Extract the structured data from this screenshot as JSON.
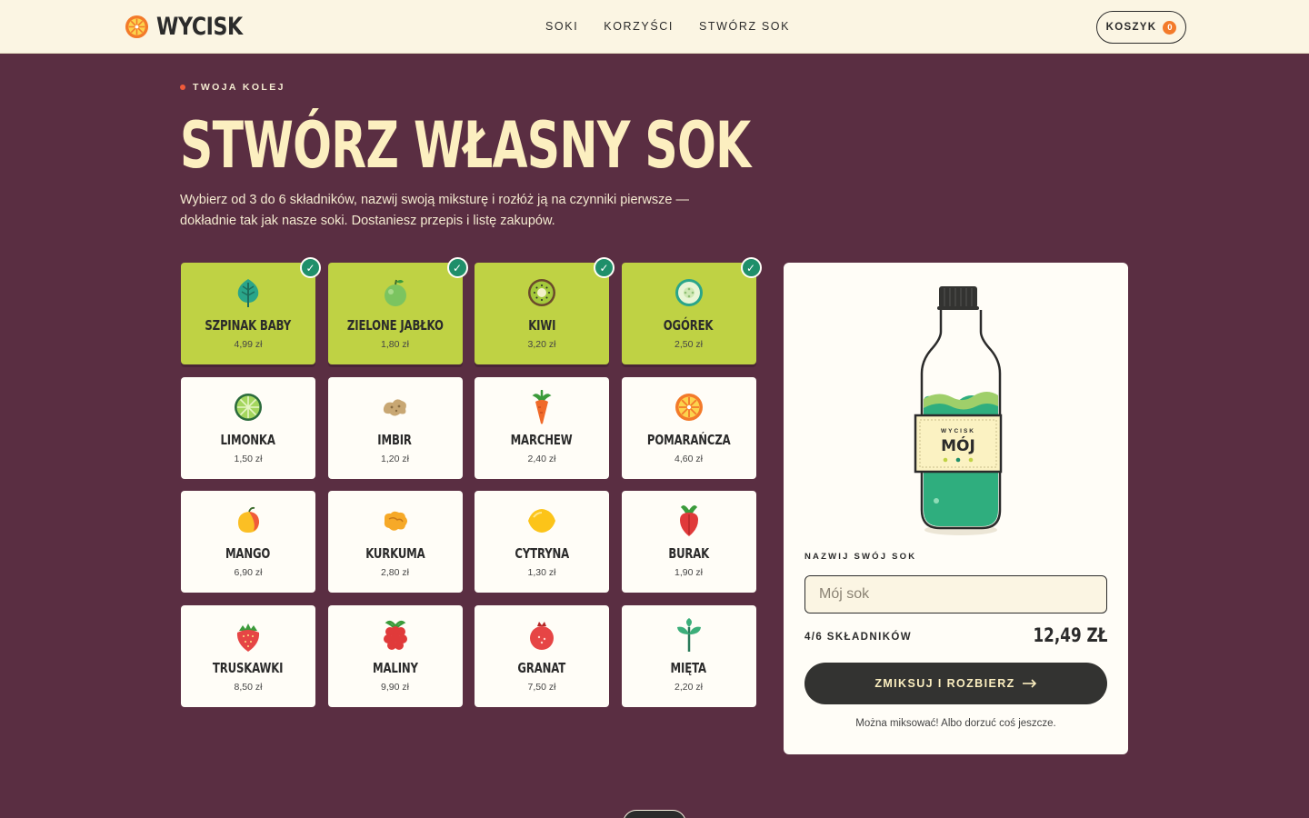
{
  "header": {
    "brand": "WYCISK",
    "nav": [
      "SOKI",
      "KORZYŚCI",
      "STWÓRZ SOK"
    ],
    "cart_label": "KOSZYK",
    "cart_count": "0"
  },
  "hero": {
    "eyebrow": "TWOJA KOLEJ",
    "title": "STWÓRZ WŁASNY SOK",
    "description": "Wybierz od 3 do 6 składników, nazwij swoją miksturę i rozłóż ją na czynniki pierwsze — dokładnie tak jak nasze soki. Dostaniesz przepis i listę zakupów."
  },
  "ingredients": [
    {
      "name": "SZPINAK BABY",
      "price": "4,99 zł",
      "selected": true,
      "icon": "spinach-leaf-icon"
    },
    {
      "name": "ZIELONE JABŁKO",
      "price": "1,80 zł",
      "selected": true,
      "icon": "green-apple-icon"
    },
    {
      "name": "KIWI",
      "price": "3,20 zł",
      "selected": true,
      "icon": "kiwi-icon"
    },
    {
      "name": "OGÓREK",
      "price": "2,50 zł",
      "selected": true,
      "icon": "cucumber-icon"
    },
    {
      "name": "LIMONKA",
      "price": "1,50 zł",
      "selected": false,
      "icon": "lime-icon"
    },
    {
      "name": "IMBIR",
      "price": "1,20 zł",
      "selected": false,
      "icon": "ginger-icon"
    },
    {
      "name": "MARCHEW",
      "price": "2,40 zł",
      "selected": false,
      "icon": "carrot-icon"
    },
    {
      "name": "POMARAŃCZA",
      "price": "4,60 zł",
      "selected": false,
      "icon": "orange-icon"
    },
    {
      "name": "MANGO",
      "price": "6,90 zł",
      "selected": false,
      "icon": "mango-icon"
    },
    {
      "name": "KURKUMA",
      "price": "2,80 zł",
      "selected": false,
      "icon": "turmeric-icon"
    },
    {
      "name": "CYTRYNA",
      "price": "1,30 zł",
      "selected": false,
      "icon": "lemon-icon"
    },
    {
      "name": "BURAK",
      "price": "1,90 zł",
      "selected": false,
      "icon": "beetroot-icon"
    },
    {
      "name": "TRUSKAWKI",
      "price": "8,50 zł",
      "selected": false,
      "icon": "strawberry-icon"
    },
    {
      "name": "MALINY",
      "price": "9,90 zł",
      "selected": false,
      "icon": "raspberry-icon"
    },
    {
      "name": "GRANAT",
      "price": "7,50 zł",
      "selected": false,
      "icon": "pomegranate-icon"
    },
    {
      "name": "MIĘTA",
      "price": "2,20 zł",
      "selected": false,
      "icon": "mint-icon"
    }
  ],
  "builder": {
    "bottle_brand": "WYCISK",
    "bottle_name": "MÓJ",
    "name_label": "NAZWIJ SWÓJ SOK",
    "name_placeholder": "Mój sok",
    "name_value": "",
    "count_label": "4/6 SKŁADNIKÓW",
    "total": "12,49 ZŁ",
    "mix_button": "ZMIKSUJ I ROZBIERZ",
    "hint": "Można miksować! Albo dorzuć coś jeszcze.",
    "liquid_color": "#2fae7e",
    "foam_color": "#9fcf6a"
  },
  "colors": {
    "background": "#5a2e42",
    "cream": "#fbf5e3",
    "selected_card": "#bfd244",
    "check": "#1f8f6a",
    "accent": "#f37a2a"
  }
}
